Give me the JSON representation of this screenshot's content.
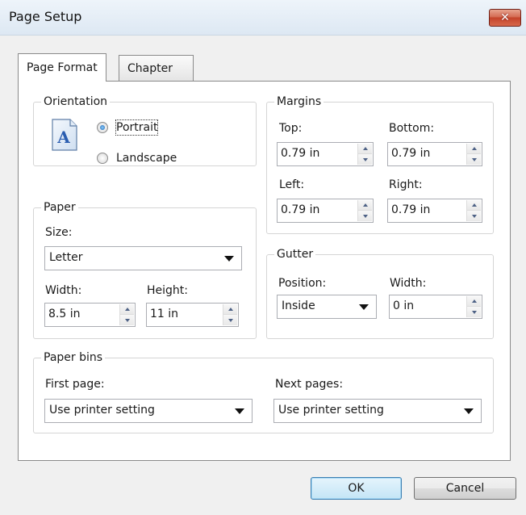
{
  "window": {
    "title": "Page Setup"
  },
  "tabs": [
    {
      "label": "Page Format",
      "active": true
    },
    {
      "label": "Chapter",
      "active": false
    }
  ],
  "orientation": {
    "legend": "Orientation",
    "portrait": {
      "label": "Portrait",
      "checked": true
    },
    "landscape": {
      "label": "Landscape",
      "checked": false
    },
    "icon_letter": "A"
  },
  "margins": {
    "legend": "Margins",
    "top": {
      "label": "Top:",
      "value": "0.79 in"
    },
    "bottom": {
      "label": "Bottom:",
      "value": "0.79 in"
    },
    "left": {
      "label": "Left:",
      "value": "0.79 in"
    },
    "right": {
      "label": "Right:",
      "value": "0.79 in"
    }
  },
  "paper": {
    "legend": "Paper",
    "size_label": "Size:",
    "size_value": "Letter",
    "width_label": "Width:",
    "width_value": "8.5 in",
    "height_label": "Height:",
    "height_value": "11 in"
  },
  "gutter": {
    "legend": "Gutter",
    "position_label": "Position:",
    "position_value": "Inside",
    "width_label": "Width:",
    "width_value": "0 in"
  },
  "paper_bins": {
    "legend": "Paper bins",
    "first_page_label": "First page:",
    "first_page_value": "Use printer setting",
    "next_pages_label": "Next pages:",
    "next_pages_value": "Use printer setting"
  },
  "buttons": {
    "ok": "OK",
    "cancel": "Cancel"
  },
  "colors": {
    "accent": "#3c7fb1",
    "close": "#c4432a",
    "radio_dot": "#1b5fae"
  }
}
